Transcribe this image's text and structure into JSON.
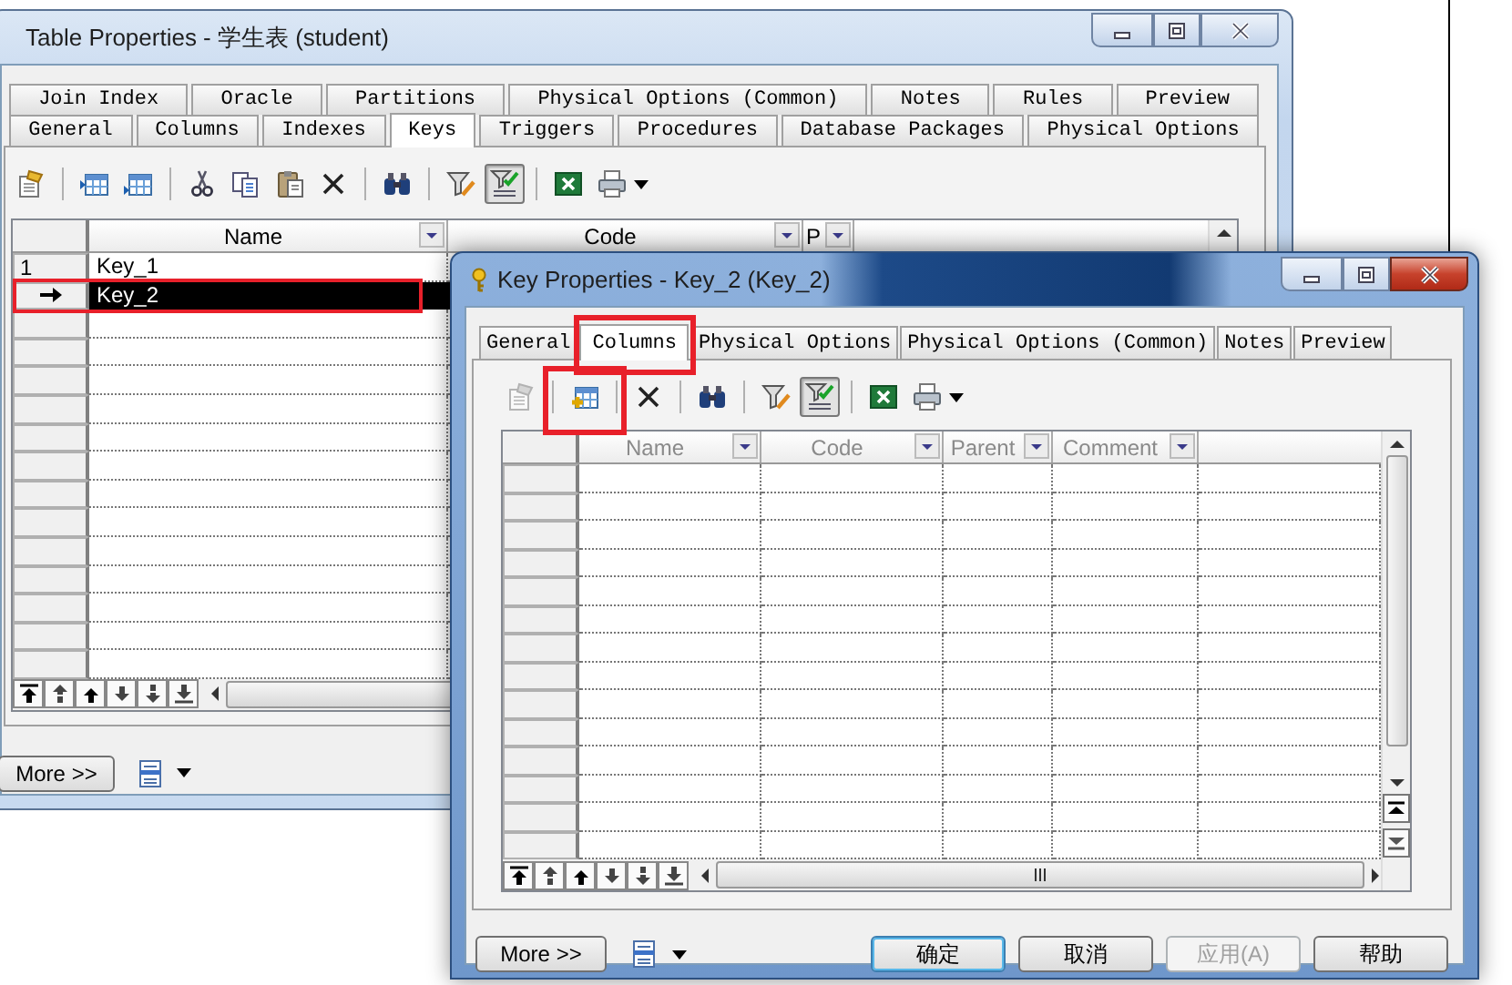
{
  "table_window": {
    "title": "Table Properties - 学生表 (student)",
    "tab_rows": [
      [
        {
          "label": "Join Index",
          "selected": false
        },
        {
          "label": "Oracle",
          "selected": false
        },
        {
          "label": "Partitions",
          "selected": false
        },
        {
          "label": "Physical Options (Common)",
          "selected": false
        },
        {
          "label": "Notes",
          "selected": false
        },
        {
          "label": "Rules",
          "selected": false
        },
        {
          "label": "Preview",
          "selected": false
        }
      ],
      [
        {
          "label": "General",
          "selected": false
        },
        {
          "label": "Columns",
          "selected": false
        },
        {
          "label": "Indexes",
          "selected": false
        },
        {
          "label": "Keys",
          "selected": true
        },
        {
          "label": "Triggers",
          "selected": false
        },
        {
          "label": "Procedures",
          "selected": false
        },
        {
          "label": "Database Packages",
          "selected": false
        },
        {
          "label": "Physical Options",
          "selected": false
        }
      ]
    ],
    "toolbar": [
      [
        {
          "kind": "properties",
          "pressed": false,
          "disabled": false,
          "highlighted": false
        }
      ],
      [
        {
          "kind": "insert-row",
          "pressed": false,
          "disabled": false,
          "highlighted": false
        },
        {
          "kind": "add-row",
          "pressed": false,
          "disabled": false,
          "highlighted": false
        }
      ],
      [
        {
          "kind": "cut",
          "pressed": false,
          "disabled": false,
          "highlighted": false
        },
        {
          "kind": "copy",
          "pressed": false,
          "disabled": false,
          "highlighted": false
        },
        {
          "kind": "paste",
          "pressed": false,
          "disabled": false,
          "highlighted": false
        },
        {
          "kind": "delete",
          "pressed": false,
          "disabled": false,
          "highlighted": false
        }
      ],
      [
        {
          "kind": "find",
          "pressed": false,
          "disabled": false,
          "highlighted": false
        }
      ],
      [
        {
          "kind": "filter",
          "pressed": false,
          "disabled": false,
          "highlighted": false
        },
        {
          "kind": "filter-check",
          "pressed": true,
          "disabled": false,
          "highlighted": false
        }
      ],
      [
        {
          "kind": "excel",
          "pressed": false,
          "disabled": false,
          "highlighted": false
        },
        {
          "kind": "print-menu",
          "pressed": false,
          "disabled": false,
          "highlighted": false
        }
      ]
    ],
    "grid": {
      "columns": [
        {
          "label": "Name"
        },
        {
          "label": "Code"
        },
        {
          "label": "P"
        }
      ],
      "rows": [
        {
          "number": "1",
          "name": "Key_1",
          "current": false,
          "selected": false,
          "highlighted": false
        },
        {
          "name": "Key_2",
          "current": true,
          "selected": true,
          "highlighted": true
        }
      ]
    },
    "more_button": "More >>"
  },
  "key_window": {
    "title": "Key Properties - Key_2 (Key_2)",
    "tabs": [
      {
        "label": "General",
        "selected": false,
        "highlighted": false
      },
      {
        "label": "Columns",
        "selected": true,
        "highlighted": true
      },
      {
        "label": "Physical Options",
        "selected": false,
        "highlighted": false
      },
      {
        "label": "Physical Options (Common)",
        "selected": false,
        "highlighted": false
      },
      {
        "label": "Notes",
        "selected": false,
        "highlighted": false
      },
      {
        "label": "Preview",
        "selected": false,
        "highlighted": false
      }
    ],
    "toolbar": [
      [
        {
          "kind": "properties",
          "pressed": false,
          "disabled": true,
          "highlighted": false
        }
      ],
      [
        {
          "kind": "add-columns",
          "pressed": false,
          "disabled": false,
          "highlighted": true
        }
      ],
      [
        {
          "kind": "delete",
          "pressed": false,
          "disabled": false,
          "highlighted": false
        }
      ],
      [
        {
          "kind": "find",
          "pressed": false,
          "disabled": false,
          "highlighted": false
        }
      ],
      [
        {
          "kind": "filter",
          "pressed": false,
          "disabled": false,
          "highlighted": false
        },
        {
          "kind": "filter-check",
          "pressed": true,
          "disabled": false,
          "highlighted": false
        }
      ],
      [
        {
          "kind": "excel",
          "pressed": false,
          "disabled": false,
          "highlighted": false
        },
        {
          "kind": "print-menu",
          "pressed": false,
          "disabled": false,
          "highlighted": false
        }
      ]
    ],
    "grid": {
      "columns": [
        {
          "label": "Name"
        },
        {
          "label": "Code"
        },
        {
          "label": "Parent"
        },
        {
          "label": "Comment"
        }
      ]
    },
    "more_button": "More >>",
    "buttons": [
      {
        "label": "确定",
        "default": true,
        "disabled": false
      },
      {
        "label": "取消",
        "default": false,
        "disabled": false
      },
      {
        "label": "应用(A)",
        "default": false,
        "disabled": true
      },
      {
        "label": "帮助",
        "default": false,
        "disabled": false
      }
    ]
  }
}
